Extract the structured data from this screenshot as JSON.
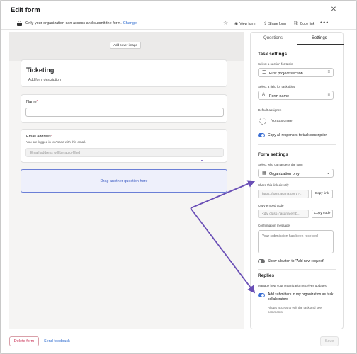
{
  "window": {
    "title": "Edit form",
    "close_icon": "close-icon"
  },
  "toolbar": {
    "access_text": "Only your organization can access and submit the form.",
    "change_link": "Change",
    "view_form": "View form",
    "share_form": "Share form",
    "copy_link": "Copy link",
    "more": "•••"
  },
  "canvas": {
    "cover_button": "Add cover image",
    "form_title": "Ticketing",
    "form_description": "Add form description",
    "questions": [
      {
        "label": "Name",
        "required": "*"
      },
      {
        "label": "Email address",
        "required": "*",
        "note": "You are logged in to Asana with this email.",
        "placeholder": "Email address will be auto-filled"
      }
    ],
    "drop_zone": "Drag another question here"
  },
  "panel": {
    "tabs": [
      "Questions",
      "Settings"
    ],
    "active_tab": "Settings",
    "task_settings": {
      "heading": "Task settings",
      "section_label": "Select a section for tasks",
      "section_value": "First project section",
      "field_label": "Select a field for task titles",
      "field_value": "Form name",
      "assignee_label": "Default assignee",
      "assignee_value": "No assignee",
      "copy_responses_label": "Copy all responses to task description",
      "copy_responses_on": true
    },
    "form_settings": {
      "heading": "Form settings",
      "access_label": "Select who can access the form",
      "access_value": "Organization only",
      "share_label": "Share this link directly",
      "share_value": "https://form.asana.com/?...",
      "copy_link_button": "Copy link",
      "embed_label": "Copy embed code",
      "embed_value": "<div class=\"asana-emb...",
      "copy_code_button": "Copy code",
      "confirmation_label": "Confirmation message",
      "confirmation_value": "Your submission has been received",
      "add_new_label": "Show a button to \"Add new request\"",
      "add_new_on": false
    },
    "replies": {
      "heading": "Replies",
      "description": "Manage how your organization receives updates",
      "collaborators_label": "Add submitters in my organization as task collaborators",
      "collaborators_sub": "Allows access to edit the task and see comments",
      "collaborators_on": true
    }
  },
  "footer": {
    "delete_button": "Delete form",
    "feedback_link": "Send feedback",
    "save_button": "Save"
  },
  "colors": {
    "accent": "#3b6fd4",
    "danger": "#c92f54",
    "link": "#2f6ccf",
    "annotation_arrow": "#6a4fb6"
  }
}
